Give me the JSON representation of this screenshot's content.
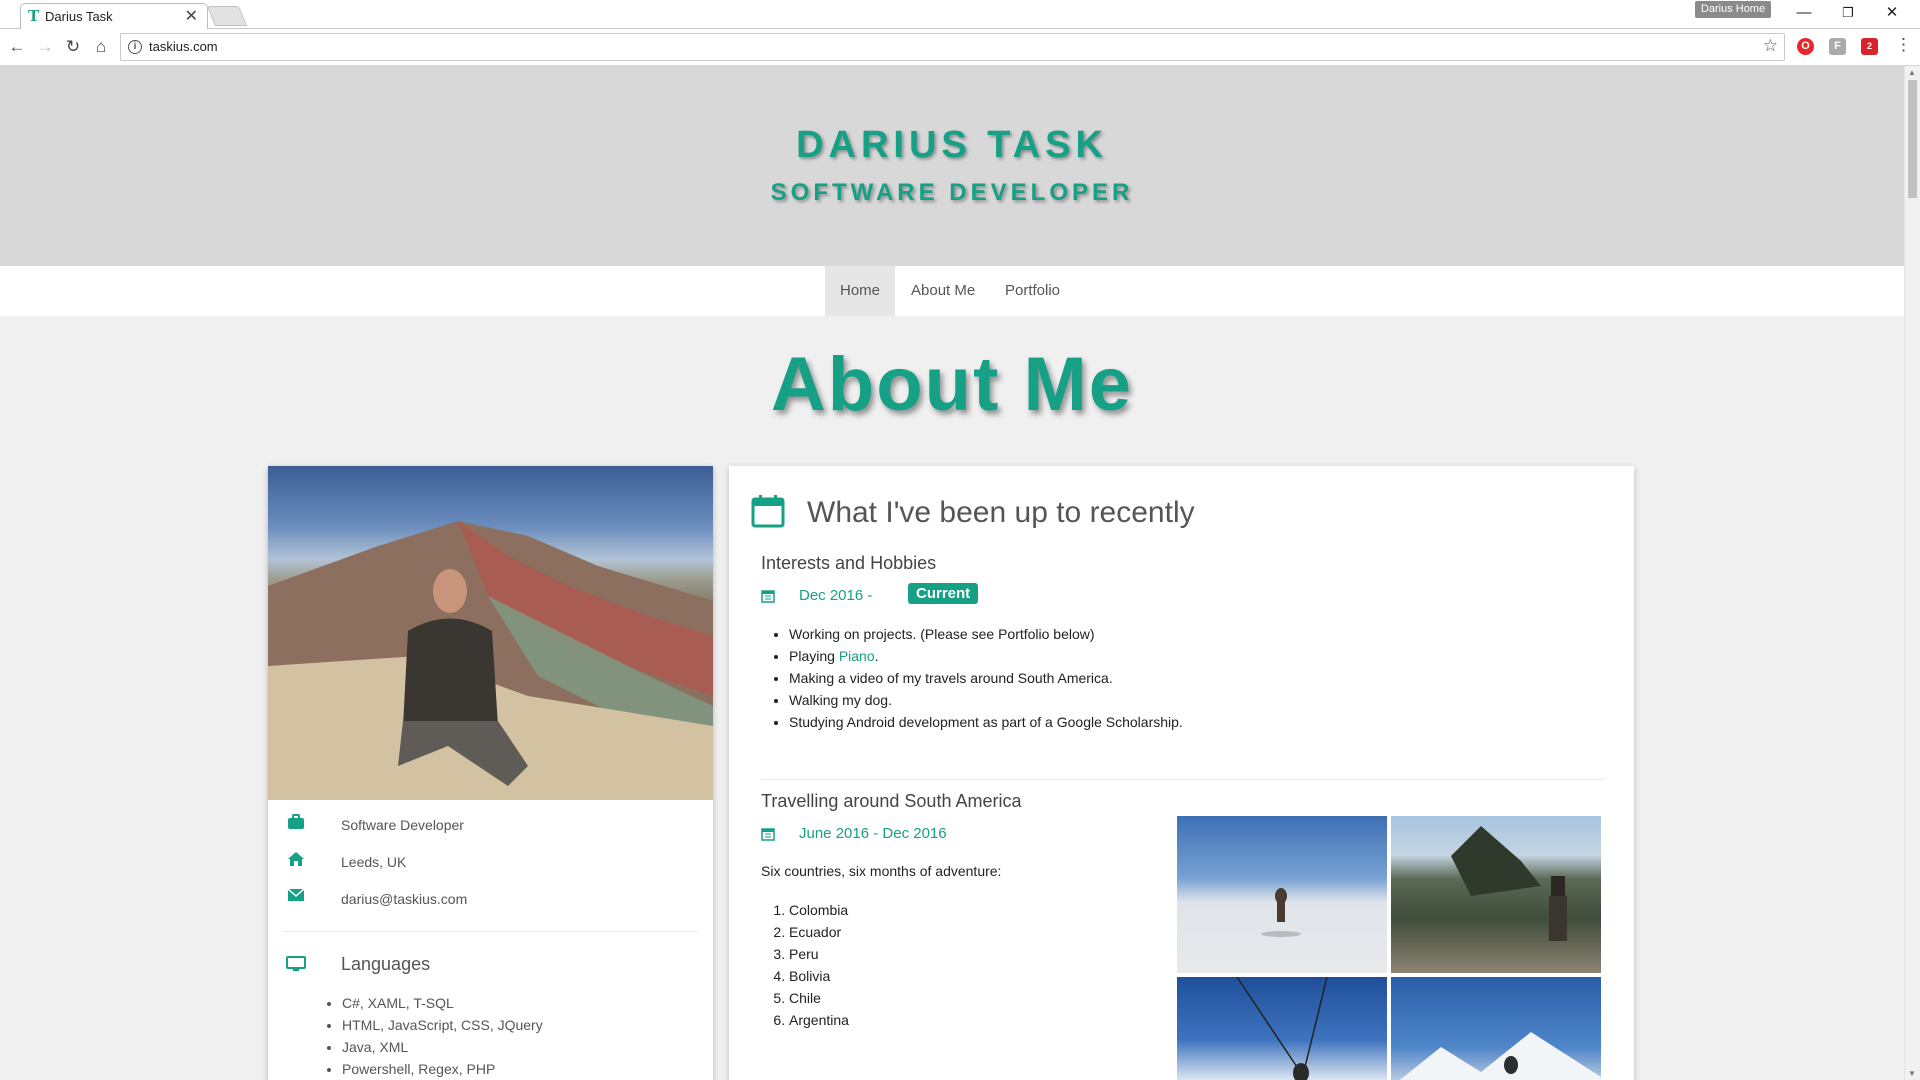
{
  "browser": {
    "tab_title": "Darius Task",
    "tab_favicon": "T",
    "tab_close": "✕",
    "profile_name": "Darius Home",
    "url": "taskius.com",
    "extension_badge": "2"
  },
  "header": {
    "site_name": "DARIUS TASK",
    "site_role": "SOFTWARE DEVELOPER"
  },
  "nav": {
    "items": [
      {
        "label": "Home",
        "active": true
      },
      {
        "label": "About Me",
        "active": false
      },
      {
        "label": "Portfolio",
        "active": false
      }
    ]
  },
  "page": {
    "heading": "About Me"
  },
  "profile": {
    "job": "Software Developer",
    "location": "Leeds, UK",
    "email": "darius@taskius.com",
    "languages_title": "Languages",
    "languages": [
      "C#, XAML, T-SQL",
      "HTML, JavaScript, CSS, JQuery",
      "Java, XML",
      "Powershell, Regex, PHP"
    ]
  },
  "experience": {
    "title": "What I've been up to recently",
    "sections": [
      {
        "title": "Interests and Hobbies",
        "date": "Dec 2016 -",
        "badge": "Current",
        "items": [
          {
            "text": "Working on projects. (Please see Portfolio below)"
          },
          {
            "prefix": "Playing ",
            "link": "Piano",
            "suffix": "."
          },
          {
            "text": "Making a video of my travels around South America."
          },
          {
            "text": "Walking my dog."
          },
          {
            "text": "Studying Android development as part of a Google Scholarship."
          }
        ]
      },
      {
        "title": "Travelling around South America",
        "date": "June 2016 - Dec 2016",
        "intro": "Six countries, six months of adventure:",
        "countries": [
          "Colombia",
          "Ecuador",
          "Peru",
          "Bolivia",
          "Chile",
          "Argentina"
        ]
      }
    ]
  },
  "colors": {
    "accent": "#16a085",
    "header_bg": "#d8d8d8",
    "page_bg": "#f0f0f0"
  },
  "icons": {
    "back": "arrow-left-icon",
    "forward": "arrow-right-icon",
    "reload": "reload-icon",
    "home": "home-icon",
    "info": "info-icon",
    "bookmark": "star-icon",
    "menu": "kebab-menu-icon",
    "job": "briefcase-icon",
    "location": "house-icon",
    "email": "envelope-icon",
    "languages": "monitor-icon",
    "calendar": "calendar-icon"
  }
}
